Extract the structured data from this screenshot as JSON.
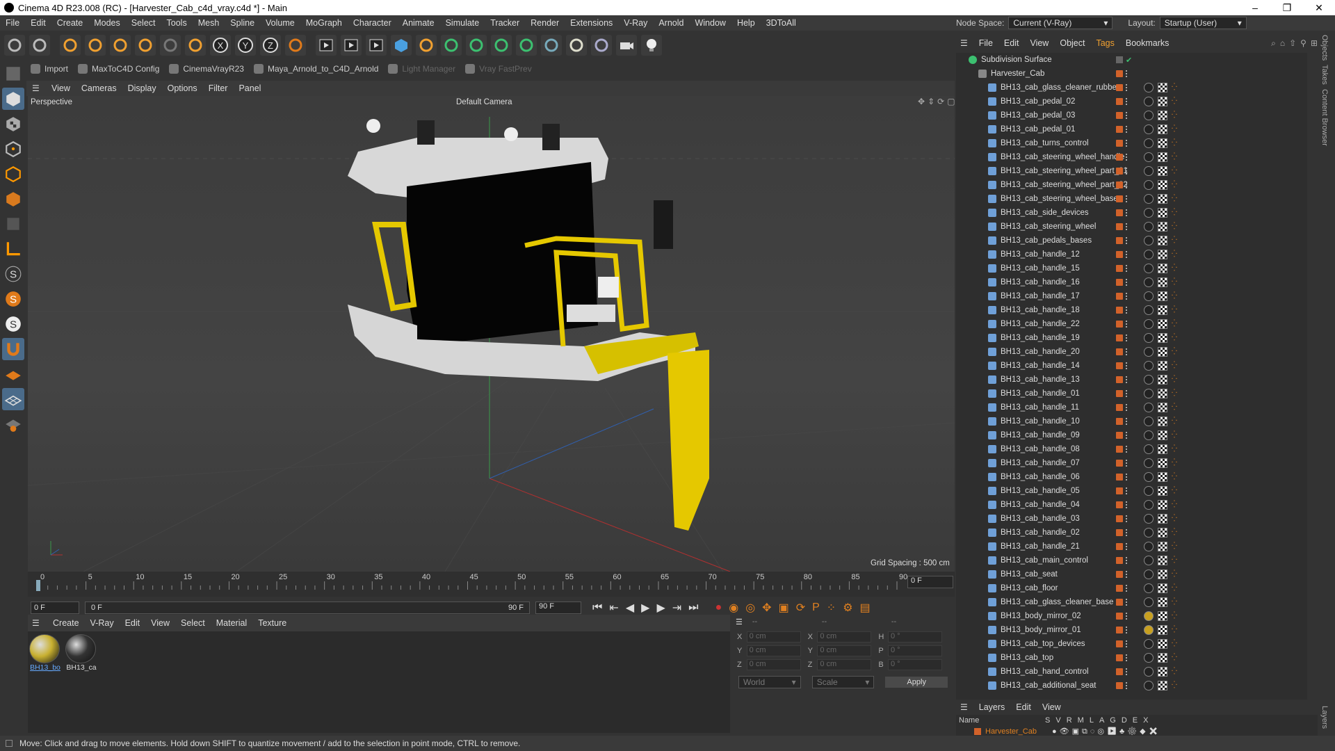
{
  "window": {
    "title": "Cinema 4D R23.008 (RC) - [Harvester_Cab_c4d_vray.c4d *] - Main",
    "controls": [
      "–",
      "❐",
      "✕"
    ]
  },
  "menu": [
    "File",
    "Edit",
    "Create",
    "Modes",
    "Select",
    "Tools",
    "Mesh",
    "Spline",
    "Volume",
    "MoGraph",
    "Character",
    "Animate",
    "Simulate",
    "Tracker",
    "Render",
    "Extensions",
    "V-Ray",
    "Arnold",
    "Window",
    "Help",
    "3DToAll"
  ],
  "nodespace": {
    "label": "Node Space:",
    "value": "Current (V-Ray)",
    "layout_label": "Layout:",
    "layout_value": "Startup (User)"
  },
  "toolbar_icons": [
    "undo-icon",
    "redo-icon",
    "select-icon",
    "move-icon",
    "scale-icon",
    "rotate-icon",
    "lock-icon",
    "move-tool-icon",
    "x-axis-icon",
    "y-axis-icon",
    "z-axis-icon",
    "coordinate-icon",
    "render-region-icon",
    "render-view-icon",
    "render-settings-icon",
    "cube-icon",
    "pen-icon",
    "subdivision-icon",
    "extrude-icon",
    "cloner-icon",
    "mograph-icon",
    "spline-tool-icon",
    "deformer-icon",
    "floor-icon",
    "camera-icon",
    "light-icon"
  ],
  "plugins": [
    {
      "label": "Import",
      "disabled": false
    },
    {
      "label": "MaxToC4D Config",
      "disabled": false
    },
    {
      "label": "CinemaVrayR23",
      "disabled": false
    },
    {
      "label": "Maya_Arnold_to_C4D_Arnold",
      "disabled": false
    },
    {
      "label": "Light Manager",
      "disabled": true
    },
    {
      "label": "Vray FastPrev",
      "disabled": true
    }
  ],
  "viewport_menu": [
    "View",
    "Cameras",
    "Display",
    "Options",
    "Filter",
    "Panel"
  ],
  "viewport": {
    "name": "Perspective",
    "camera": "Default Camera",
    "grid_spacing": "Grid Spacing : 500 cm"
  },
  "timeline": {
    "ticks": [
      "0",
      "5",
      "10",
      "15",
      "20",
      "25",
      "30",
      "35",
      "40",
      "45",
      "50",
      "55",
      "60",
      "65",
      "70",
      "75",
      "80",
      "85",
      "90"
    ],
    "current": "0 F"
  },
  "transport": {
    "start": "0 F",
    "mid": "0 F",
    "end_a": "90 F",
    "end_b": "90 F"
  },
  "material_menu": [
    "Create",
    "V-Ray",
    "Edit",
    "View",
    "Select",
    "Material",
    "Texture"
  ],
  "materials": [
    {
      "label": "BH13_bo",
      "color": "#c8b030"
    },
    {
      "label": "BH13_ca",
      "color": "#333333"
    }
  ],
  "attributes": {
    "rows": [
      {
        "a": "X",
        "av": "0 cm",
        "b": "X",
        "bv": "0 cm",
        "c": "H",
        "cv": "0 °"
      },
      {
        "a": "Y",
        "av": "0 cm",
        "b": "Y",
        "bv": "0 cm",
        "c": "P",
        "cv": "0 °"
      },
      {
        "a": "Z",
        "av": "0 cm",
        "b": "Z",
        "bv": "0 cm",
        "c": "B",
        "cv": "0 °"
      }
    ],
    "world": "World",
    "scale": "Scale",
    "apply": "Apply",
    "dashes": [
      "--",
      "--",
      "--"
    ]
  },
  "object_menu": [
    "File",
    "Edit",
    "View",
    "Object",
    "Tags",
    "Bookmarks"
  ],
  "objects": [
    "Subdivision Surface",
    "Harvester_Cab",
    "BH13_cab_glass_cleaner_rubber",
    "BH13_cab_pedal_02",
    "BH13_cab_pedal_03",
    "BH13_cab_pedal_01",
    "BH13_cab_turns_control",
    "BH13_cab_steering_wheel_handle",
    "BH13_cab_steering_wheel_part_01",
    "BH13_cab_steering_wheel_part_02",
    "BH13_cab_steering_wheel_base",
    "BH13_cab_side_devices",
    "BH13_cab_steering_wheel",
    "BH13_cab_pedals_bases",
    "BH13_cab_handle_12",
    "BH13_cab_handle_15",
    "BH13_cab_handle_16",
    "BH13_cab_handle_17",
    "BH13_cab_handle_18",
    "BH13_cab_handle_22",
    "BH13_cab_handle_19",
    "BH13_cab_handle_20",
    "BH13_cab_handle_14",
    "BH13_cab_handle_13",
    "BH13_cab_handle_01",
    "BH13_cab_handle_11",
    "BH13_cab_handle_10",
    "BH13_cab_handle_09",
    "BH13_cab_handle_08",
    "BH13_cab_handle_07",
    "BH13_cab_handle_06",
    "BH13_cab_handle_05",
    "BH13_cab_handle_04",
    "BH13_cab_handle_03",
    "BH13_cab_handle_02",
    "BH13_cab_handle_21",
    "BH13_cab_main_control",
    "BH13_cab_seat",
    "BH13_cab_floor",
    "BH13_cab_glass_cleaner_base",
    "BH13_body_mirror_02",
    "BH13_body_mirror_01",
    "BH13_cab_top_devices",
    "BH13_cab_top",
    "BH13_cab_hand_control",
    "BH13_cab_additional_seat"
  ],
  "right_tabs": [
    "Objects",
    "Takes",
    "Content Browser",
    "Layers"
  ],
  "layers": {
    "menu": [
      "Layers",
      "Edit",
      "View"
    ],
    "header": {
      "name": "Name",
      "cols": [
        "S",
        "V",
        "R",
        "M",
        "L",
        "A",
        "G",
        "D",
        "E",
        "X"
      ]
    },
    "row": "Harvester_Cab"
  },
  "status": "Move: Click and drag to move elements. Hold down SHIFT to quantize movement / add to the selection in point mode, CTRL to remove."
}
